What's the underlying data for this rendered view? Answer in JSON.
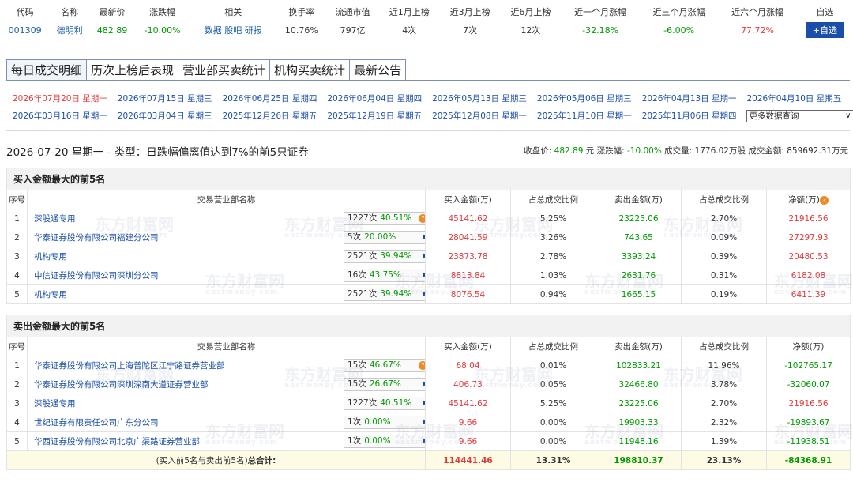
{
  "stock": {
    "headers": [
      "代码",
      "名称",
      "最新价",
      "涨跌幅",
      "相关",
      "换手率",
      "流通市值",
      "近1月上榜",
      "近3月上榜",
      "近6月上榜",
      "近一个月涨幅",
      "近三个月涨幅",
      "近六个月涨幅",
      "自选"
    ],
    "code": "001309",
    "name": "德明利",
    "price": "482.89",
    "change": "-10.00%",
    "links": [
      "数据",
      "股吧",
      "研报"
    ],
    "turnover": "10.76%",
    "float_cap": "797亿",
    "m1": "4次",
    "m3": "7次",
    "m6": "12次",
    "r1": "-32.18%",
    "r3": "-6.00%",
    "r6": "77.72%",
    "add_label": "+自选"
  },
  "tabs": [
    "每日成交明细",
    "历次上榜后表现",
    "营业部买卖统计",
    "机构买卖统计",
    "最新公告"
  ],
  "dates": [
    "2026年07月20日 星期一",
    "2026年07月15日 星期三",
    "2026年06月25日 星期四",
    "2026年06月04日 星期四",
    "2026年05月13日 星期三",
    "2026年05月06日 星期三",
    "2026年04月13日 星期一",
    "2026年04月10日 星期五",
    "2026年03月16日 星期一",
    "2026年03月04日 星期三",
    "2025年12月26日 星期五",
    "2025年12月19日 星期五",
    "2025年12月08日 星期一",
    "2025年11月10日 星期一",
    "2025年11月06日 星期四"
  ],
  "more_label": "更多数据查询",
  "summary": {
    "title": "2026-07-20 星期一 - 类型：日跌幅偏离值达到7%的前5只证券",
    "close_label": "收盘价:",
    "close": "482.89",
    "close_unit": "元",
    "chg_label": "涨跌幅:",
    "chg": "-10.00%",
    "vol_label": "成交量:",
    "vol": "1776.02万股",
    "amt_label": "成交金额:",
    "amt": "859692.31万元"
  },
  "col_headers": [
    "序号",
    "交易营业部名称",
    "买入金额(万)",
    "占总成交比例",
    "卖出金额(万)",
    "占总成交比例",
    "净额(万)"
  ],
  "buy": {
    "title": "买入金额最大的前5名",
    "rows": [
      {
        "idx": "1",
        "name": "深股通专用",
        "cnt": "1227次",
        "pct": "40.51%",
        "icon": "dot",
        "buy": "45141.62",
        "bp": "5.25%",
        "sell": "23225.06",
        "sp": "2.70%",
        "net": "21916.56"
      },
      {
        "idx": "2",
        "name": "华泰证券股份有限公司福建分公司",
        "cnt": "5次",
        "pct": "20.00%",
        "icon": "arrow",
        "buy": "28041.59",
        "bp": "3.26%",
        "sell": "743.65",
        "sp": "0.09%",
        "net": "27297.93"
      },
      {
        "idx": "3",
        "name": "机构专用",
        "cnt": "2521次",
        "pct": "39.94%",
        "icon": "arrow",
        "buy": "23873.78",
        "bp": "2.78%",
        "sell": "3393.24",
        "sp": "0.39%",
        "net": "20480.53"
      },
      {
        "idx": "4",
        "name": "中信证券股份有限公司深圳分公司",
        "cnt": "16次",
        "pct": "43.75%",
        "icon": "arrow",
        "buy": "8813.84",
        "bp": "1.03%",
        "sell": "2631.76",
        "sp": "0.31%",
        "net": "6182.08"
      },
      {
        "idx": "5",
        "name": "机构专用",
        "cnt": "2521次",
        "pct": "39.94%",
        "icon": "arrow",
        "buy": "8076.54",
        "bp": "0.94%",
        "sell": "1665.15",
        "sp": "0.19%",
        "net": "6411.39"
      }
    ]
  },
  "sell": {
    "title": "卖出金额最大的前5名",
    "rows": [
      {
        "idx": "1",
        "name": "华泰证券股份有限公司上海普陀区江宁路证券营业部",
        "cnt": "15次",
        "pct": "46.67%",
        "icon": "dot",
        "buy": "68.04",
        "bp": "0.01%",
        "sell": "102833.21",
        "sp": "11.96%",
        "net": "-102765.17"
      },
      {
        "idx": "2",
        "name": "华泰证券股份有限公司深圳深南大道证券营业部",
        "cnt": "15次",
        "pct": "26.67%",
        "icon": "arrow",
        "buy": "406.73",
        "bp": "0.05%",
        "sell": "32466.80",
        "sp": "3.78%",
        "net": "-32060.07"
      },
      {
        "idx": "3",
        "name": "深股通专用",
        "cnt": "1227次",
        "pct": "40.51%",
        "icon": "arrow",
        "buy": "45141.62",
        "bp": "5.25%",
        "sell": "23225.06",
        "sp": "2.70%",
        "net": "21916.56"
      },
      {
        "idx": "4",
        "name": "世纪证券有限责任公司广东分公司",
        "cnt": "1次",
        "pct": "0.00%",
        "icon": "arrow",
        "buy": "9.66",
        "bp": "0.00%",
        "sell": "19903.33",
        "sp": "2.32%",
        "net": "-19893.67"
      },
      {
        "idx": "5",
        "name": "华西证券股份有限公司北京广渠路证券营业部",
        "cnt": "1次",
        "pct": "0.00%",
        "icon": "arrow",
        "buy": "9.66",
        "bp": "0.00%",
        "sell": "11948.16",
        "sp": "1.39%",
        "net": "-11938.51"
      }
    ]
  },
  "total": {
    "label_pre": "(买入前5名与卖出前5名)",
    "label_bold": "总合计:",
    "buy": "114441.46",
    "bp": "13.31%",
    "sell": "198810.37",
    "sp": "23.13%",
    "net": "-84368.91"
  },
  "watermark": {
    "cn": "东方财富网",
    "en": "eastmoney.com"
  },
  "colors": {
    "up": "#e4393c",
    "down": "#009900",
    "link": "#1a4ea8",
    "accent": "#1a4ea8"
  }
}
